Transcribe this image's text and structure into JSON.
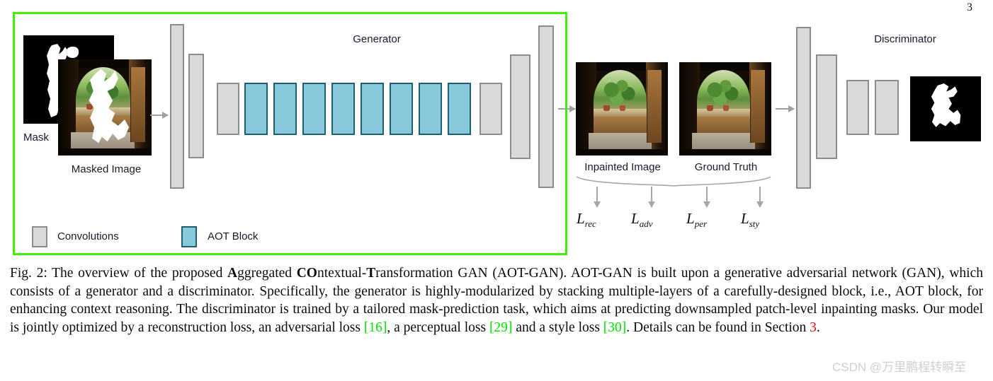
{
  "page": {
    "number": "3"
  },
  "figure": {
    "generator_label": "Generator",
    "discriminator_label": "Discriminator",
    "inputs": {
      "mask_label": "Mask",
      "masked_image_label": "Masked Image"
    },
    "outputs": {
      "inpainted_label": "Inpainted Image",
      "ground_truth_label": "Ground Truth"
    },
    "losses": [
      {
        "name": "L",
        "sub": "rec"
      },
      {
        "name": "L",
        "sub": "adv"
      },
      {
        "name": "L",
        "sub": "per"
      },
      {
        "name": "L",
        "sub": "sty"
      }
    ],
    "legend": [
      {
        "label": "Convolutions",
        "color": "#d9d9d9",
        "border": "#8c8c8c"
      },
      {
        "label": "AOT Block",
        "color": "#87c9da",
        "border": "#1d5f72"
      }
    ],
    "colors": {
      "highlight_box": "#3ff000",
      "conv_fill": "#d9d9d9",
      "conv_border": "#8c8c8c",
      "aot_fill": "#87c9da",
      "aot_border": "#1d5f72",
      "arrow": "#a0a0a0",
      "citation": "#00e000",
      "section_ref": "#e01010"
    },
    "generator_blocks": {
      "encoder_conv_count": 3,
      "aot_block_count": 8,
      "decoder_conv_count": 3
    },
    "discriminator_blocks": {
      "conv_count": 4
    }
  },
  "caption": {
    "prefix": "Fig. 2: ",
    "t1": "The overview of the proposed ",
    "b1": "A",
    "t2": "ggregated ",
    "b2": "CO",
    "t3": "ntextual-",
    "b3": "T",
    "t4": "ransformation GAN (AOT-GAN). AOT-GAN is built upon a generative adversarial network (GAN), which consists of a generator and a discriminator. Specifically, the generator is highly-modularized by stacking multiple-layers of a carefully-designed block, i.e., AOT block, for enhancing context reasoning. The discriminator is trained by a tailored mask-prediction task, which aims at predicting downsampled patch-level inpainting masks. Our model is jointly optimized by a reconstruction loss, an adversarial loss ",
    "c1": "[16]",
    "t5": ", a perceptual loss ",
    "c2": "[29]",
    "t6": " and a style loss ",
    "c3": "[30]",
    "t7": ". Details can be found in Section ",
    "sec": "3",
    "t8": "."
  },
  "watermark": {
    "text": "CSDN @万里鹏程转瞬至"
  }
}
